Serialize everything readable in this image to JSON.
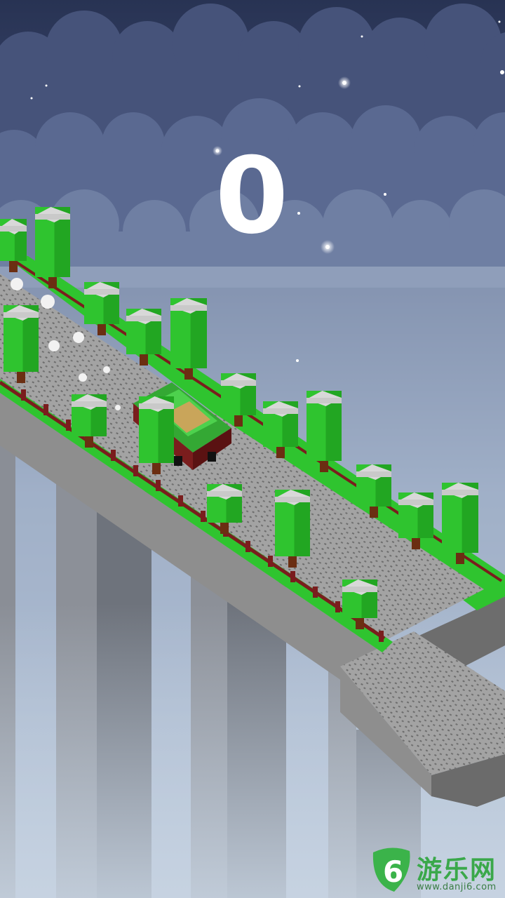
{
  "hud": {
    "score": "0"
  },
  "watermark": {
    "brand": "游乐网",
    "url": "www.danji6.com",
    "logo_glyph": "6"
  },
  "colors": {
    "sky_top": "#2a3558",
    "sky_mid": "#55668c",
    "sky_bottom": "#b9c8da",
    "cloud": "#7c8aac",
    "road": "#9a9a9a",
    "tree_green": "#2fc42f",
    "snow": "#d8d8d8",
    "fence": "#7a1d1d",
    "car_green": "#3fb83f"
  }
}
